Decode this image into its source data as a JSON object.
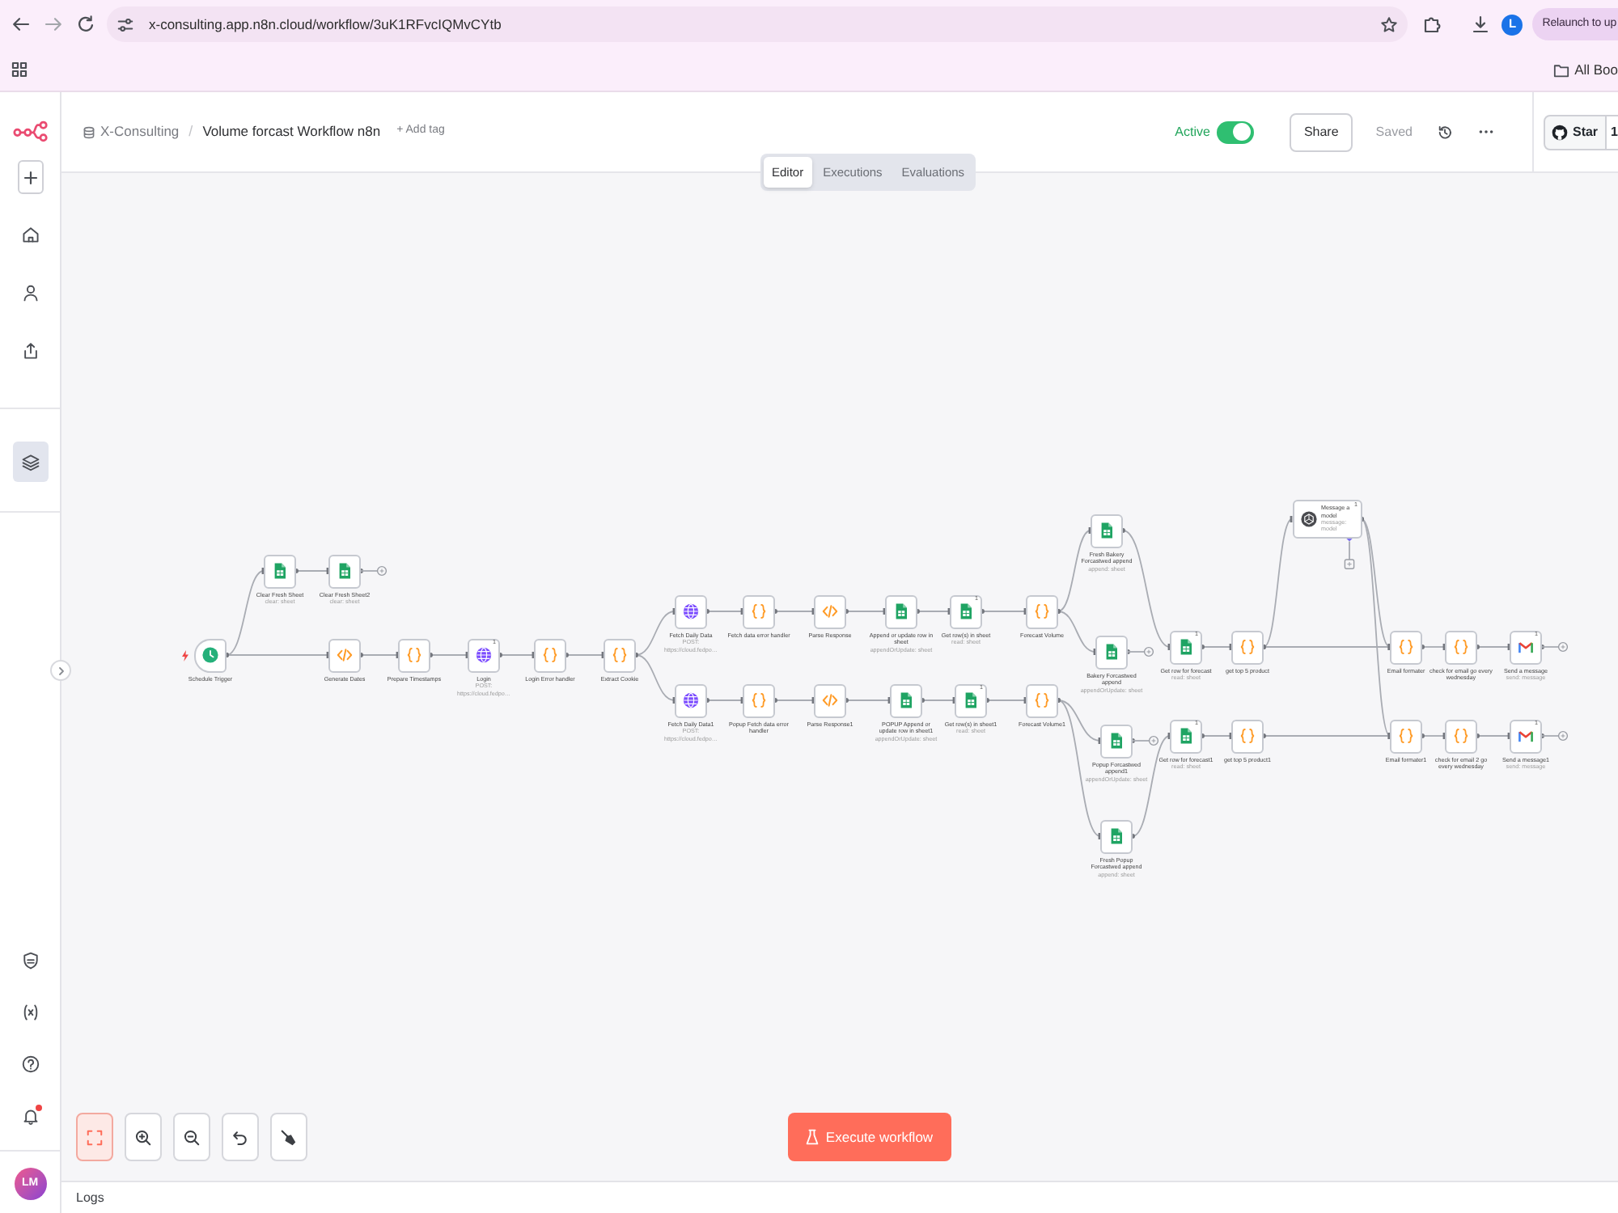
{
  "browser": {
    "url": "x-consulting.app.n8n.cloud/workflow/3uK1RFvcIQMvCYtb",
    "profile_initial": "L",
    "relaunch": "Relaunch to up",
    "bookmark_folder": "All Boo"
  },
  "sidebar": {
    "items": [
      {
        "kind": "home",
        "selected": false
      },
      {
        "kind": "user",
        "selected": false
      },
      {
        "kind": "share",
        "selected": false
      }
    ],
    "projects": [
      {
        "kind": "layers",
        "selected": true
      }
    ],
    "bottom_items": [
      {
        "kind": "shield",
        "unread": false
      },
      {
        "kind": "variables",
        "unread": false
      },
      {
        "kind": "help",
        "unread": false
      },
      {
        "kind": "bell",
        "unread": true
      }
    ],
    "avatar": {
      "initials": "LM"
    }
  },
  "header": {
    "project": "X-Consulting",
    "separator": "/",
    "workflow_name": "Volume forcast Workflow n8n",
    "add_tag": "+ Add tag",
    "active_label": "Active",
    "active": true,
    "share": "Share",
    "save_status": "Saved",
    "github": {
      "label": "Star",
      "count": "1"
    }
  },
  "tabs": [
    {
      "label": "Editor",
      "selected": true
    },
    {
      "label": "Executions",
      "selected": false
    },
    {
      "label": "Evaluations",
      "selected": false
    }
  ],
  "nodes": [
    {
      "kind": "schedule",
      "label": "Schedule Trigger"
    },
    {
      "kind": "sheets",
      "label": "Clear Fresh Sheet",
      "subtitle": "clear: sheet"
    },
    {
      "kind": "sheets",
      "label": "Clear Fresh Sheet2",
      "subtitle": "clear: sheet"
    },
    {
      "kind": "html",
      "label": "Generate Dates"
    },
    {
      "kind": "code",
      "label": "Prepare Timestamps"
    },
    {
      "kind": "http",
      "label": "Login",
      "subtitle": "POST: https://cloud.fedpo…",
      "badge": "1"
    },
    {
      "kind": "code",
      "label": "Login Error handler"
    },
    {
      "kind": "code",
      "label": "Extract Cookie"
    },
    {
      "kind": "http",
      "label": "Fetch Daily Data",
      "subtitle": "POST: https://cloud.fedpo…"
    },
    {
      "kind": "code",
      "label": "Fetch data error handler"
    },
    {
      "kind": "html",
      "label": "Parse Response"
    },
    {
      "kind": "sheets",
      "label": "Append or update row in sheet",
      "subtitle": "appendOrUpdate: sheet"
    },
    {
      "kind": "sheets",
      "label": "Get row(s) in sheet",
      "subtitle": "read: sheet",
      "badge": "1"
    },
    {
      "kind": "code",
      "label": "Forecast Volume"
    },
    {
      "kind": "http",
      "label": "Fetch Daily Data1",
      "subtitle": "POST: https://cloud.fedpo…"
    },
    {
      "kind": "code",
      "label": "Popup Fetch data error handler"
    },
    {
      "kind": "html",
      "label": "Parse Response1"
    },
    {
      "kind": "sheets",
      "label": "POPUP Append or update row in sheet1",
      "subtitle": "appendOrUpdate: sheet"
    },
    {
      "kind": "sheets",
      "label": "Get row(s) in sheet1",
      "subtitle": "read: sheet",
      "badge": "1"
    },
    {
      "kind": "code",
      "label": "Forecast Volume1"
    },
    {
      "kind": "sheets",
      "label": "Fresh Bakery Forcastwed append",
      "subtitle": "append: sheet"
    },
    {
      "kind": "sheets",
      "label": "Bakery Forcastwed append",
      "subtitle": "appendOrUpdate: sheet"
    },
    {
      "kind": "sheets",
      "label": "Popup Forcastwed append1",
      "subtitle": "appendOrUpdate: sheet"
    },
    {
      "kind": "sheets",
      "label": "Fresh Popup Forcastwed append",
      "subtitle": "append: sheet"
    },
    {
      "kind": "sheets",
      "label": "Get row for forecast",
      "subtitle": "read: sheet",
      "badge": "1"
    },
    {
      "kind": "code",
      "label": "get top 5 product"
    },
    {
      "kind": "sheets",
      "label": "Get row for forecast1",
      "subtitle": "read: sheet",
      "badge": "1"
    },
    {
      "kind": "code",
      "label": "get top 5 product1"
    },
    {
      "kind": "model",
      "label": "Message a model",
      "subtitle": "message: model",
      "badge": "1"
    },
    {
      "kind": "code",
      "label": "Email formater"
    },
    {
      "kind": "code",
      "label": "check for email go every wednesday"
    },
    {
      "kind": "gmail",
      "label": "Send a message",
      "subtitle": "send: message",
      "badge": "1"
    },
    {
      "kind": "code",
      "label": "Email formater1"
    },
    {
      "kind": "code",
      "label": "check for email 2 go every wednesday"
    },
    {
      "kind": "gmail",
      "label": "Send a message1",
      "subtitle": "send: message",
      "badge": "1"
    }
  ],
  "canvas_controls": [
    {
      "kind": "fit",
      "selected": true
    },
    {
      "kind": "zoom_in",
      "selected": false
    },
    {
      "kind": "zoom_out",
      "selected": false
    },
    {
      "kind": "undo",
      "selected": false
    },
    {
      "kind": "tidy",
      "selected": false
    }
  ],
  "execute_button": "Execute workflow",
  "logs": "Logs"
}
